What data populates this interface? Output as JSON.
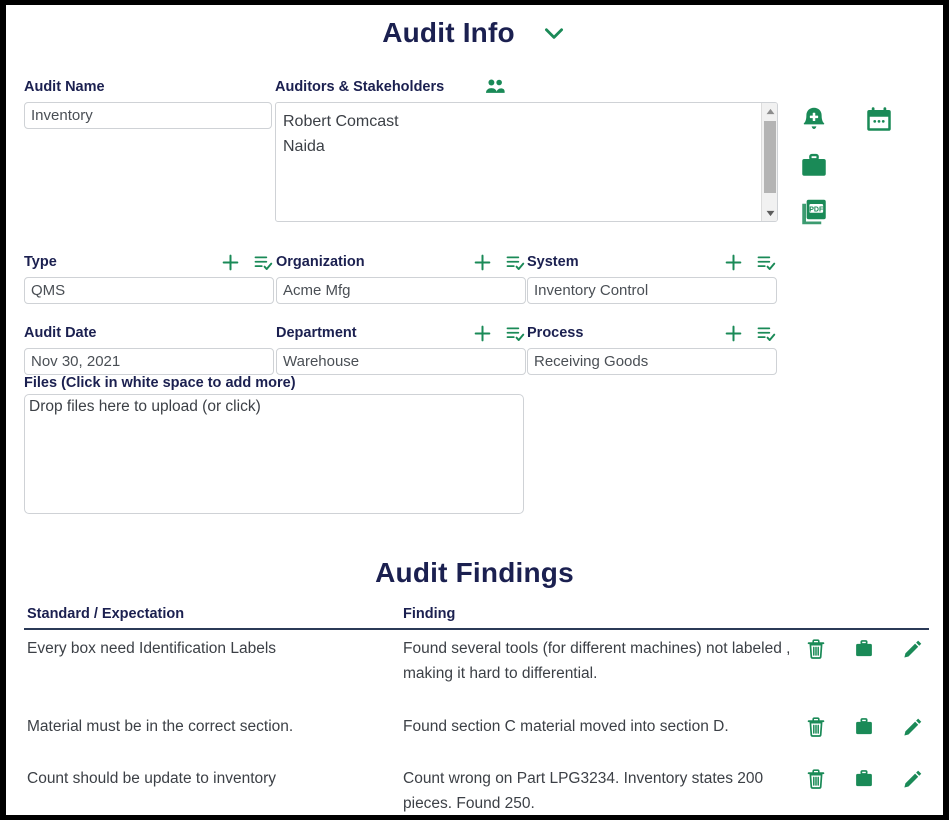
{
  "theme": {
    "accent_green": "#1a8a57",
    "heading_navy": "#1b2050",
    "text_gray": "#3c4046",
    "border_gray": "#cfd2d6",
    "frame_black": "#000000"
  },
  "audit_info": {
    "title": "Audit Info",
    "collapse_icon": "chevron-down-icon",
    "audit_name": {
      "label": "Audit Name",
      "value": "Inventory"
    },
    "auditors": {
      "label": "Auditors & Stakeholders",
      "people_icon": "users-icon",
      "entries": [
        "Robert Comcast",
        "Naida"
      ]
    },
    "quick_actions": [
      {
        "name": "add-alert-button",
        "icon": "bell-plus-icon",
        "label": "Add Alert"
      },
      {
        "name": "calendar-button",
        "icon": "calendar-icon",
        "label": "Calendar"
      },
      {
        "name": "toolbox-button",
        "icon": "briefcase-icon",
        "label": "Toolbox"
      },
      {
        "name": "pdf-export-button",
        "icon": "pdf-icon",
        "label": "PDF"
      }
    ],
    "fields_row1": [
      {
        "label": "Type",
        "value": "QMS",
        "add_icon": "plus-icon",
        "list_icon": "list-check-icon",
        "has_icons": true
      },
      {
        "label": "Organization",
        "value": "Acme Mfg",
        "add_icon": "plus-icon",
        "list_icon": "list-check-icon",
        "has_icons": true
      },
      {
        "label": "System",
        "value": "Inventory Control",
        "add_icon": "plus-icon",
        "list_icon": "list-check-icon",
        "has_icons": true
      }
    ],
    "fields_row2": [
      {
        "label": "Audit Date",
        "value": "Nov 30, 2021",
        "add_icon": "",
        "list_icon": "",
        "has_icons": false
      },
      {
        "label": "Department",
        "value": "Warehouse",
        "add_icon": "plus-icon",
        "list_icon": "list-check-icon",
        "has_icons": true
      },
      {
        "label": "Process",
        "value": "Receiving Goods",
        "add_icon": "plus-icon",
        "list_icon": "list-check-icon",
        "has_icons": true
      }
    ],
    "files": {
      "label": "Files (Click in white space to add more)",
      "dropzone_text": "Drop files here to upload (or click)"
    }
  },
  "audit_findings": {
    "title": "Audit Findings",
    "columns": [
      "Standard / Expectation",
      "Finding"
    ],
    "row_actions": [
      {
        "name": "delete-finding-button",
        "icon": "trash-icon"
      },
      {
        "name": "toolbox-finding-button",
        "icon": "briefcase-icon"
      },
      {
        "name": "edit-finding-button",
        "icon": "pencil-icon"
      }
    ],
    "rows": [
      {
        "standard": "Every box need Identification Labels",
        "finding": "Found several tools (for different machines) not labeled , making it hard to differential."
      },
      {
        "standard": "Material must be in the correct section.",
        "finding": "Found section C material moved into section D."
      },
      {
        "standard": "Count should be update to inventory",
        "finding": "Count wrong on Part LPG3234. Inventory states 200 pieces. Found 250."
      }
    ]
  }
}
